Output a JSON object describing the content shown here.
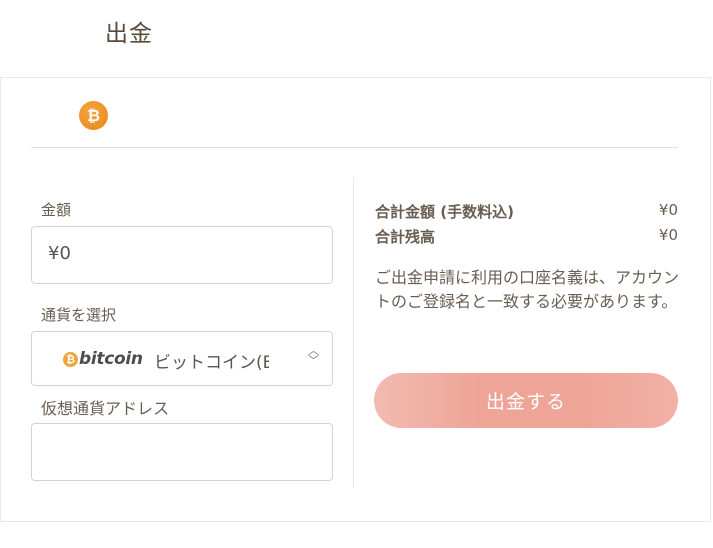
{
  "page": {
    "title": "出金"
  },
  "tabs": [
    {
      "icon": "bitcoin-icon",
      "glyph": "₿"
    }
  ],
  "form": {
    "amount_label": "金額",
    "amount_value": "¥0",
    "currency_label": "通貨を選択",
    "currency_logo_text": "bitcoin",
    "currency_value": "ビットコイン(BTC)",
    "address_label": "仮想通貨アドレス",
    "address_value": ""
  },
  "summary": {
    "total_label": "合計金額 (手数料込)",
    "total_value": "¥0",
    "balance_label": "合計残高",
    "balance_value": "¥0",
    "notice": "ご出金申請に利用の口座名義は、アカウントのご登録名と一致する必要があります。",
    "submit_label": "出金する"
  },
  "colors": {
    "bitcoin": "#f0951e",
    "button": "#eea497",
    "title": "#5a4a3a"
  }
}
